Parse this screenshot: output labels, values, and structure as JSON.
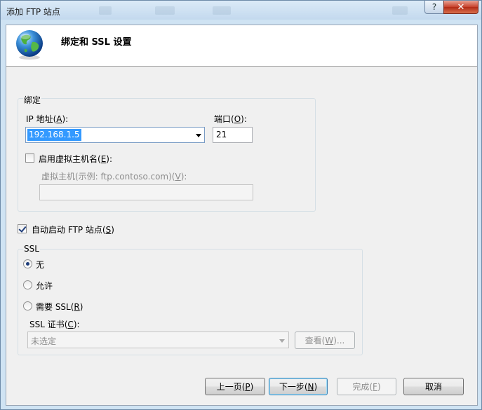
{
  "window": {
    "title": "添加 FTP 站点"
  },
  "header": {
    "title": "绑定和 SSL 设置"
  },
  "binding": {
    "group_label": "绑定",
    "ip_label": "IP 地址(",
    "ip_key": "A",
    "ip_label_end": "):",
    "ip_value": "192.168.1.5",
    "port_label": "端口(",
    "port_key": "O",
    "port_label_end": "):",
    "port_value": "21",
    "vhost_checkbox_label": "启用虚拟主机名(",
    "vhost_checkbox_key": "E",
    "vhost_checkbox_end": "):",
    "vhost_checked": false,
    "vhost_field_label": "虚拟主机(示例: ftp.contoso.com)(",
    "vhost_field_key": "V",
    "vhost_field_end": "):",
    "vhost_value": ""
  },
  "autostart": {
    "label": "自动启动 FTP 站点(",
    "key": "S",
    "end": ")",
    "checked": true
  },
  "ssl": {
    "group_label": "SSL",
    "options": [
      {
        "label": "无",
        "key": "",
        "end": "",
        "selected": true
      },
      {
        "label": "允许",
        "key": "",
        "end": "",
        "selected": false
      },
      {
        "label": "需要 SSL(",
        "key": "R",
        "end": ")",
        "selected": false
      }
    ],
    "cert_label": "SSL 证书(",
    "cert_key": "C",
    "cert_end": "):",
    "cert_value": "未选定",
    "view_label": "查看(",
    "view_key": "W",
    "view_end": ")..."
  },
  "buttons": {
    "prev": {
      "label": "上一页(",
      "key": "P",
      "end": ")"
    },
    "next": {
      "label": "下一步(",
      "key": "N",
      "end": ")"
    },
    "finish": {
      "label": "完成(",
      "key": "F",
      "end": ")"
    },
    "cancel": {
      "label": "取消"
    }
  },
  "titlebar_buttons": {
    "help": "?",
    "close": "✕"
  },
  "colors": {
    "selection": "#3399ff",
    "window_frame": "#cfe3f3",
    "close_button": "#c7412b"
  }
}
